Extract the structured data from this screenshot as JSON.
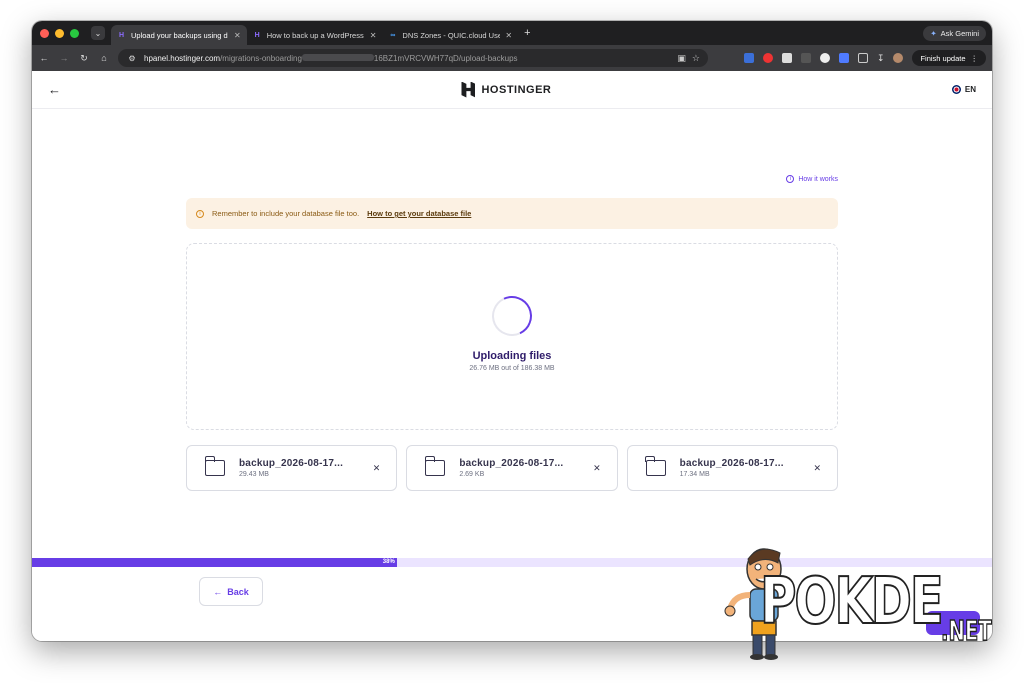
{
  "browser": {
    "tabs": [
      {
        "title": "Upload your backups using d",
        "active": true,
        "favicon": "hostinger-icon"
      },
      {
        "title": "How to back up a WordPress",
        "active": false,
        "favicon": "hostinger-icon"
      },
      {
        "title": "DNS Zones - QUIC.cloud Use",
        "active": false,
        "favicon": "quic-cloud-icon"
      }
    ],
    "ask_gemini": "Ask Gemini",
    "url_host": "hpanel.hostinger.com",
    "url_path_start": "/migrations-onboarding",
    "url_path_end": "16BZ1mVRCVWH77qD/upload-backups",
    "finish_update": "Finish update"
  },
  "header": {
    "brand": "HOSTINGER",
    "language": "EN"
  },
  "how_it_works": "How it works",
  "alert": {
    "text": "Remember to include your database file too.",
    "link": "How to get your database file"
  },
  "upload": {
    "title": "Uploading files",
    "subtitle": "26.76 MB out of 186.38 MB"
  },
  "files": [
    {
      "name": "backup_2026-08-17...",
      "size": "29.43 MB"
    },
    {
      "name": "backup_2026-08-17...",
      "size": "2.69 KB"
    },
    {
      "name": "backup_2026-08-17...",
      "size": "17.34 MB"
    }
  ],
  "progress": {
    "label": "38%",
    "value": 0.38
  },
  "back_label": "Back",
  "watermark": {
    "main": "POKDE",
    "suffix": ".NET"
  },
  "colors": {
    "accent": "#673de6",
    "alert_bg": "#fcf1e3"
  }
}
